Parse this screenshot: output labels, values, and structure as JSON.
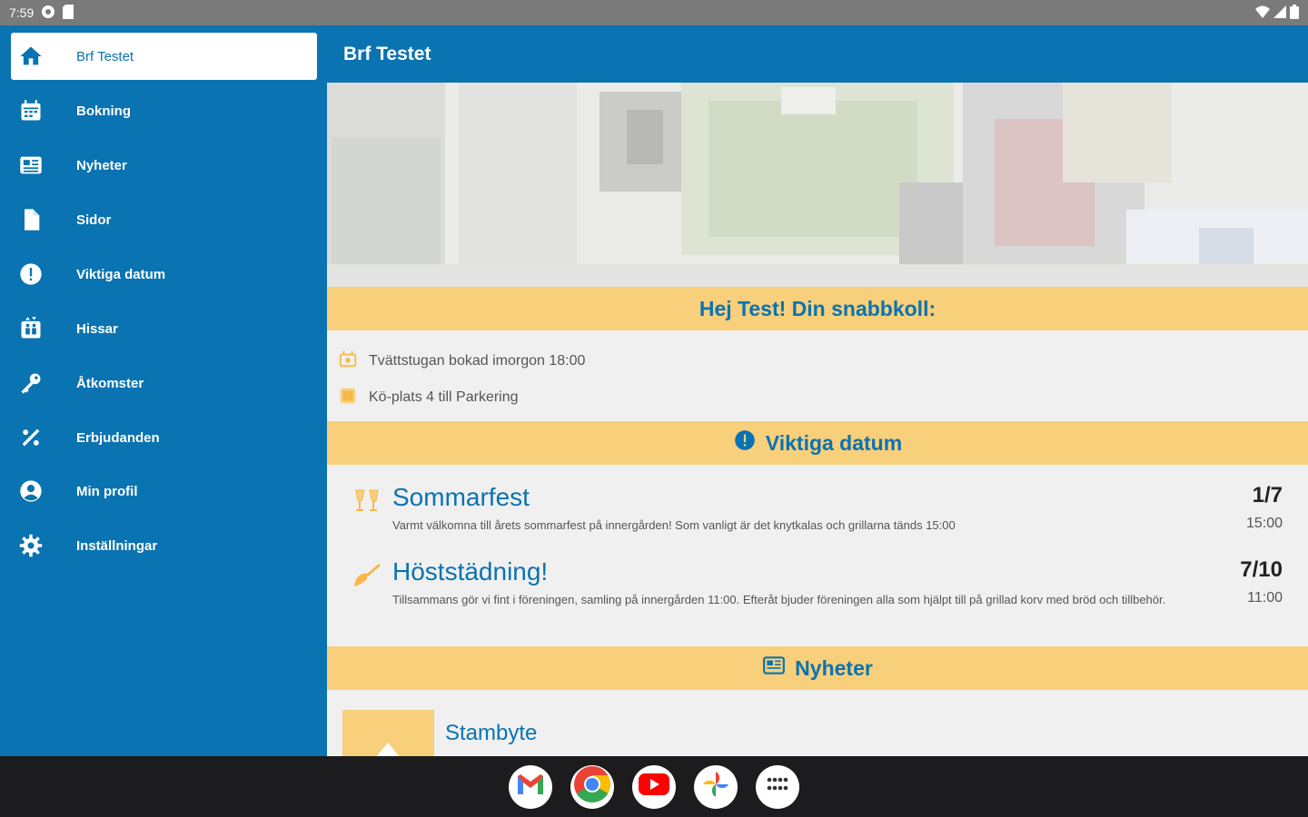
{
  "status_bar": {
    "time": "7:59"
  },
  "sidebar": {
    "items": [
      {
        "label": "Brf Testet",
        "icon": "home-icon"
      },
      {
        "label": "Bokning",
        "icon": "calendar-icon"
      },
      {
        "label": "Nyheter",
        "icon": "newspaper-icon"
      },
      {
        "label": "Sidor",
        "icon": "page-icon"
      },
      {
        "label": "Viktiga datum",
        "icon": "alert-circle-icon"
      },
      {
        "label": "Hissar",
        "icon": "elevator-icon"
      },
      {
        "label": "Åtkomster",
        "icon": "key-icon"
      },
      {
        "label": "Erbjudanden",
        "icon": "percent-icon"
      },
      {
        "label": "Min profil",
        "icon": "account-icon"
      },
      {
        "label": "Inställningar",
        "icon": "gear-icon"
      }
    ]
  },
  "appbar": {
    "title": "Brf Testet"
  },
  "quick_check": {
    "heading": "Hej Test! Din snabbkoll:",
    "items": [
      {
        "text": "Tvättstugan bokad imorgon 18:00",
        "icon": "washer-icon"
      },
      {
        "text": "Kö-plats 4 till Parkering",
        "icon": "parking-icon"
      }
    ]
  },
  "important_dates": {
    "heading": "Viktiga datum",
    "events": [
      {
        "title": "Sommarfest",
        "description": "Varmt välkomna till årets sommarfest på innergården! Som vanligt är det knytkalas och grillarna tänds 15:00",
        "day": "1/7",
        "time": "15:00",
        "icon": "cheers-icon"
      },
      {
        "title": "Höststädning!",
        "description": "Tillsammans gör vi fint i föreningen, samling på innergården 11:00. Efteråt bjuder föreningen alla som hjälpt till på grillad korv med bröd och tillbehör.",
        "day": "7/10",
        "time": "11:00",
        "icon": "broom-icon"
      }
    ]
  },
  "news": {
    "heading": "Nyheter",
    "items": [
      {
        "title": "Stambyte"
      }
    ]
  },
  "dock": {
    "apps": [
      {
        "name": "Gmail",
        "icon": "gmail-icon"
      },
      {
        "name": "Chrome",
        "icon": "chrome-icon"
      },
      {
        "name": "YouTube",
        "icon": "youtube-icon"
      },
      {
        "name": "Photos",
        "icon": "photos-icon"
      },
      {
        "name": "Apps",
        "icon": "app-grid-icon"
      }
    ]
  },
  "colors": {
    "primary": "#0a73b1",
    "accent": "#f8cf7a",
    "background": "#f0f0f0"
  }
}
